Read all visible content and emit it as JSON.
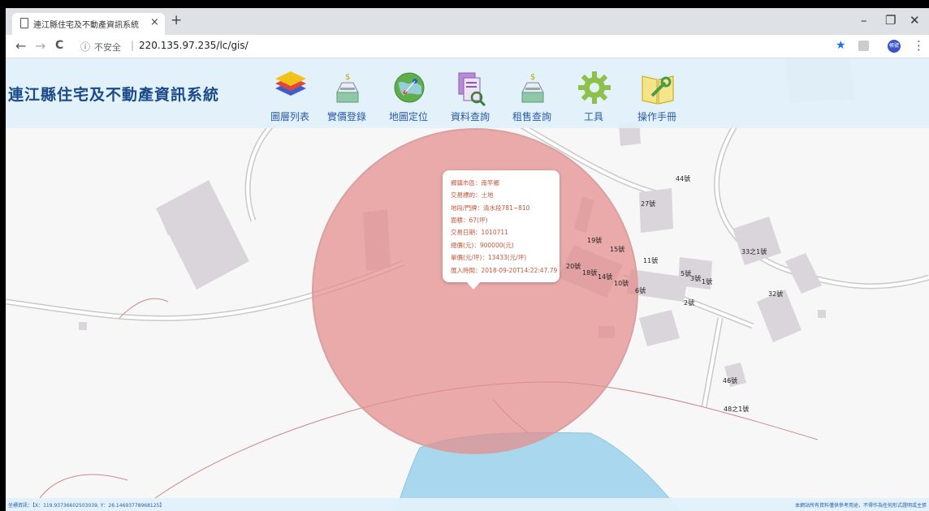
{
  "browser": {
    "tab_title": "連江縣住宅及不動產資訊系統",
    "tab_close": "×",
    "new_tab": "+",
    "win_min": "–",
    "win_max": "❐",
    "win_close": "✕",
    "back": "←",
    "forward": "→",
    "reload": "C",
    "insecure_label": "不安全",
    "separator": "|",
    "url": "220.135.97.235/lc/gis/",
    "profile_label": "帳號",
    "menu": "⋮"
  },
  "app": {
    "title": "連江縣住宅及不動產資訊系統",
    "tools": [
      {
        "label": "圖層列表",
        "icon": "layers-icon"
      },
      {
        "label": "實價登錄",
        "icon": "price-register-icon"
      },
      {
        "label": "地圖定位",
        "icon": "globe-locate-icon"
      },
      {
        "label": "資料查詢",
        "icon": "data-search-icon"
      },
      {
        "label": "租售查詢",
        "icon": "rent-sale-search-icon"
      },
      {
        "label": "工具",
        "icon": "gear-icon"
      },
      {
        "label": "操作手冊",
        "icon": "manual-icon"
      }
    ]
  },
  "popup": {
    "rows": [
      "鄉鎮市區：南竿鄉",
      "交易標的：土地",
      "地段/門牌：清水段781~810",
      "面積：67(坪)",
      "交易日期：1010711",
      "總價(元)：900000(元)",
      "單價(元/坪)：13433(元/坪)",
      "匯入時間：2018-09-20T14:22:47.79"
    ]
  },
  "map": {
    "house_numbers": [
      "44號",
      "27號",
      "19號",
      "15號",
      "11號",
      "20號",
      "18號",
      "14號",
      "10號",
      "6號",
      "5號",
      "3號",
      "1號",
      "2號",
      "33之1號",
      "32號",
      "46號",
      "48之1號"
    ]
  },
  "status": {
    "coords": "坐標資訊：【X：119.93736602503039, Y：26.146937789681​25】",
    "disclaimer": "本網站所有資料僅供參考用途，不得作為任何形式證明或主張"
  },
  "colors": {
    "header_bg": "#e1f1fa",
    "title_blue": "#1a4a8a",
    "label_blue": "#2b5aa8",
    "buffer_circle": "#e58c8c",
    "water": "#a9d8ee",
    "popup_text": "#c0573a"
  }
}
